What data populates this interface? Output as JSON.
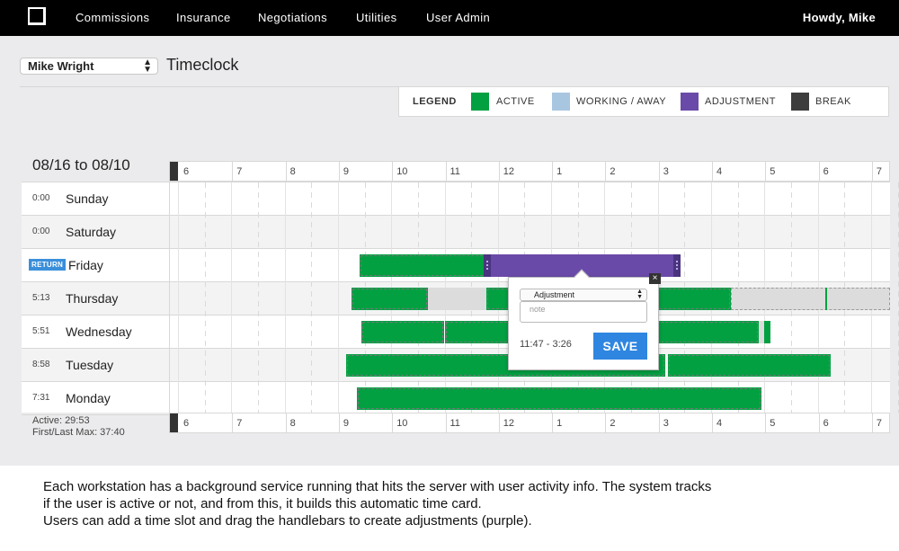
{
  "nav": {
    "items": [
      "Commissions",
      "Insurance",
      "Negotiations",
      "Utilities",
      "User Admin"
    ],
    "greeting": "Howdy, Mike"
  },
  "header": {
    "user_select": "Mike Wright",
    "title": "Timeclock"
  },
  "legend": {
    "label": "LEGEND",
    "items": [
      {
        "label": "ACTIVE",
        "color": "#03a042"
      },
      {
        "label": "WORKING / AWAY",
        "color": "#a9c6e0"
      },
      {
        "label": "ADJUSTMENT",
        "color": "#6a4aa8"
      },
      {
        "label": "BREAK",
        "color": "#3d3d3d"
      }
    ]
  },
  "range_title": "08/16 to 08/10",
  "hours": [
    "6",
    "7",
    "8",
    "9",
    "10",
    "11",
    "12",
    "1",
    "2",
    "3",
    "4",
    "5",
    "6",
    "7"
  ],
  "days": [
    {
      "time": "0:00",
      "name": "Sunday"
    },
    {
      "time": "0:00",
      "name": "Saturday"
    },
    {
      "time": "",
      "name": "Friday",
      "badge": "RETURN"
    },
    {
      "time": "5:13",
      "name": "Thursday"
    },
    {
      "time": "5:51",
      "name": "Wednesday"
    },
    {
      "time": "8:58",
      "name": "Tuesday"
    },
    {
      "time": "7:31",
      "name": "Monday"
    }
  ],
  "stats": {
    "active": "Active: 29:53",
    "first_last": "First/Last Max: 37:40"
  },
  "popup": {
    "type": "Adjustment",
    "note_placeholder": "note",
    "time_range": "11:47 - 3:26",
    "save_label": "SAVE",
    "close_label": "×"
  },
  "caption": [
    "Each workstation has a background service running that hits the server with user activity info. The system tracks",
    "if the user is active or not, and from this, it builds this automatic time card.",
    "Users can add a time slot and drag the handlebars to create adjustments (purple)."
  ]
}
